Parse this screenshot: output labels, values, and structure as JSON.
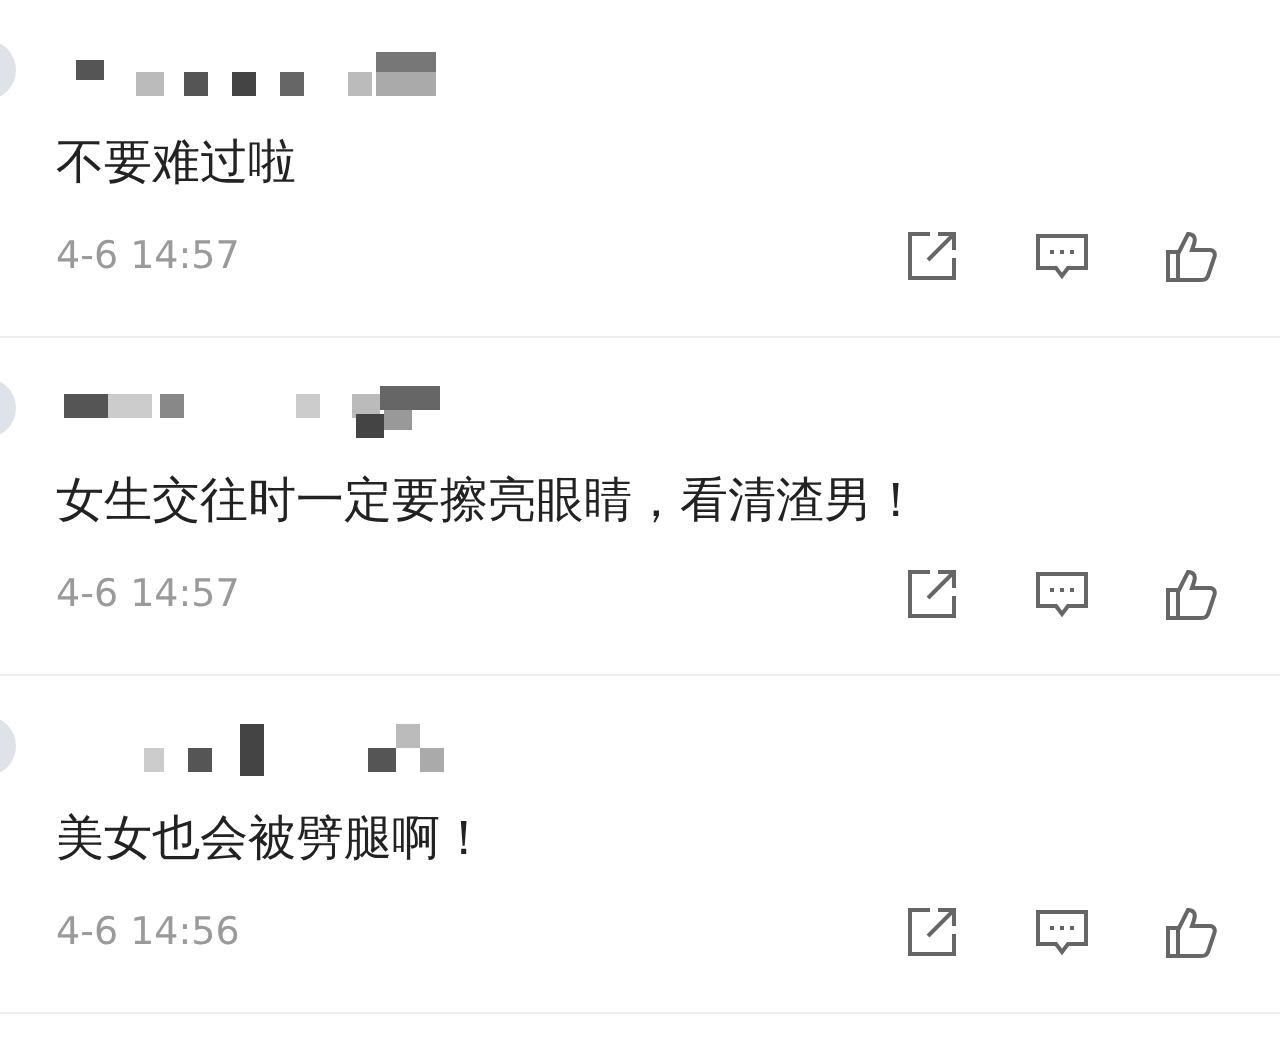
{
  "comments": [
    {
      "text": "不要难过啦",
      "time": "4-6 14:57"
    },
    {
      "text": "女生交往时一定要擦亮眼睛，看清渣男！",
      "time": "4-6 14:57"
    },
    {
      "text": "美女也会被劈腿啊！",
      "time": "4-6 14:56"
    }
  ]
}
